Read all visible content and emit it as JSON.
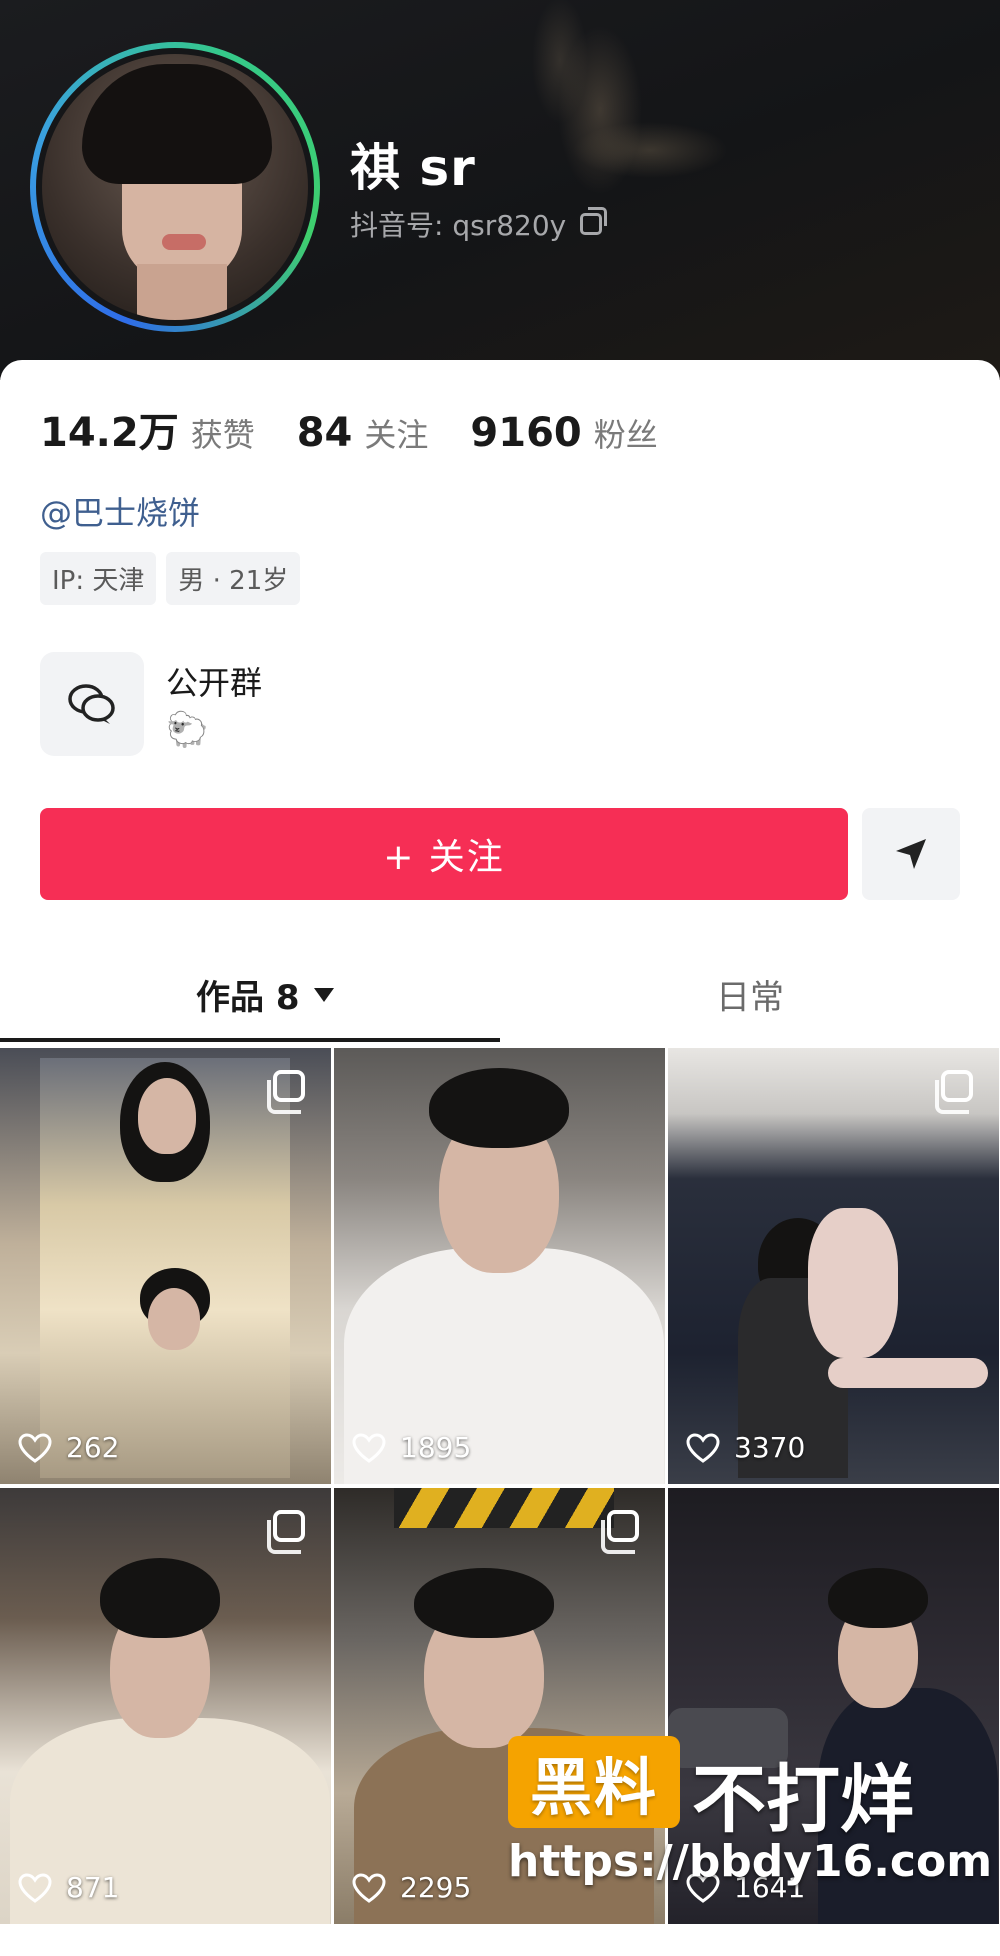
{
  "profile": {
    "name": "祺 sr",
    "douyin_id": "抖音号: qsr820y"
  },
  "stats": [
    {
      "value": "14.2万",
      "label": "获赞"
    },
    {
      "value": "84",
      "label": "关注"
    },
    {
      "value": "9160",
      "label": "粉丝"
    }
  ],
  "bio": {
    "mention": "@巴士烧饼",
    "tags": [
      "IP: 天津",
      "男 · 21岁"
    ]
  },
  "group": {
    "title": "公开群",
    "emoji": "🐑"
  },
  "actions": {
    "follow_label": "+ 关注"
  },
  "tabs": {
    "works_label": "作品 8",
    "daily_label": "日常"
  },
  "grid": [
    {
      "likes": "262"
    },
    {
      "likes": "1895"
    },
    {
      "likes": "3370"
    },
    {
      "likes": "871"
    },
    {
      "likes": "2295"
    },
    {
      "likes": "1641"
    }
  ],
  "watermark": {
    "badge": "黑料",
    "text": "不打烊",
    "url": "https://bbdy16.com"
  },
  "colors": {
    "accent": "#f62e55",
    "mention": "#3f5f8f",
    "watermark_badge": "#f5a300"
  }
}
